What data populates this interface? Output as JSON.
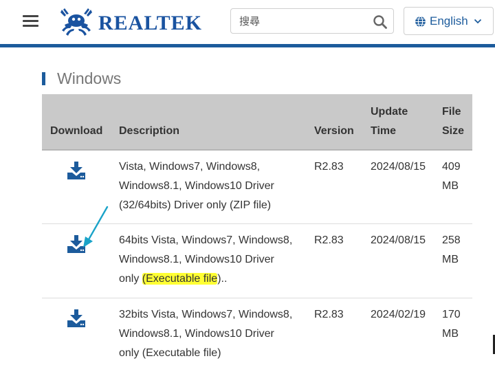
{
  "header": {
    "brand": "REALTEK",
    "search": {
      "placeholder": "搜尋",
      "value": ""
    },
    "language": {
      "selected": "English"
    }
  },
  "section": {
    "title": "Windows"
  },
  "table": {
    "columns": {
      "download": "Download",
      "description": "Description",
      "version": "Version",
      "update_time_1": "Update",
      "update_time_2": "Time",
      "file_size_1": "File",
      "file_size_2": "Size"
    },
    "rows": [
      {
        "description_lines": [
          "Vista, Windows7, Windows8,",
          "Windows8.1, Windows10 Driver",
          "(32/64bits) Driver only (ZIP file)"
        ],
        "version": "R2.83",
        "update_time": "2024/08/15",
        "size_value": "409",
        "size_unit": "MB"
      },
      {
        "description_lines": [
          "64bits Vista, Windows7, Windows8,",
          "Windows8.1, Windows10 Driver"
        ],
        "description_last_prefix": "only ",
        "description_last_highlight": "(Executable file",
        "description_last_suffix": ")..",
        "version": "R2.83",
        "update_time": "2024/08/15",
        "size_value": "258",
        "size_unit": "MB"
      },
      {
        "description_lines": [
          "32bits Vista, Windows7, Windows8,",
          "Windows8.1, Windows10 Driver",
          "only (Executable file)"
        ],
        "version": "R2.83",
        "update_time": "2024/02/19",
        "size_value": "170",
        "size_unit": "MB"
      }
    ]
  },
  "colors": {
    "brand_blue": "#1c5b9c",
    "header_gray": "#c9c9c9",
    "highlight": "#ffff33",
    "annotation_arrow": "#1aa3c8"
  },
  "icons": [
    "hamburger-icon",
    "realtek-crab-logo",
    "search-icon",
    "globe-icon",
    "chevron-down-icon",
    "download-icon",
    "annotation-arrow"
  ]
}
